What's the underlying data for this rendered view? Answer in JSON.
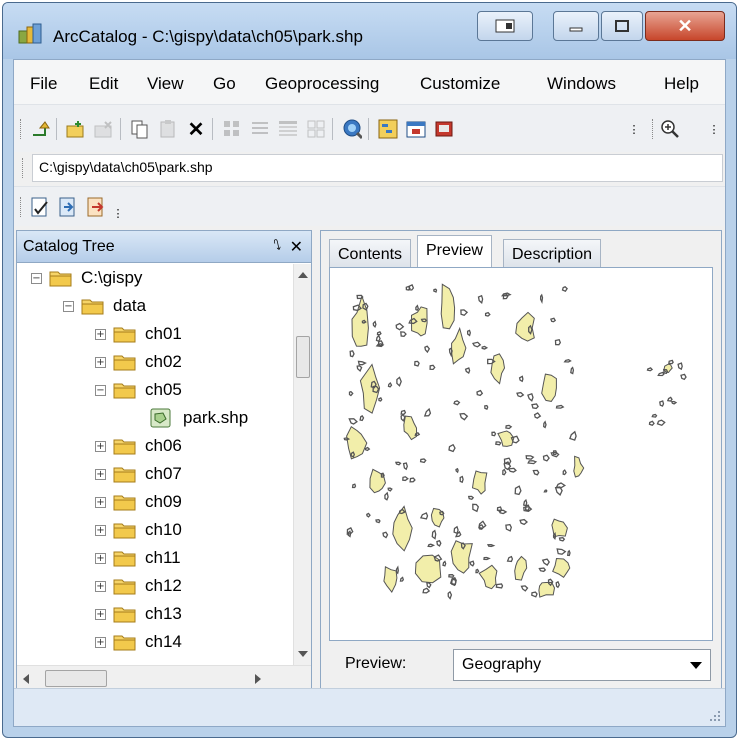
{
  "window": {
    "title": "ArcCatalog - C:\\gispy\\data\\ch05\\park.shp"
  },
  "menu": [
    "File",
    "Edit",
    "View",
    "Go",
    "Geoprocessing",
    "Customize",
    "Windows",
    "Help"
  ],
  "toolbar_icons": [
    "up-one-level-icon",
    "connect-folder-icon",
    "disconnect-folder-icon",
    "copy-icon",
    "paste-icon",
    "delete-icon",
    "large-icons-icon",
    "list-icon",
    "details-icon",
    "thumbnails-icon",
    "search-icon",
    "catalog-tree-icon",
    "arctoolbox-icon",
    "model-icon",
    "zoom-in-icon"
  ],
  "address": {
    "value": "C:\\gispy\\data\\ch05\\park.shp"
  },
  "catalog": {
    "title": "Catalog Tree",
    "pin": "⭛",
    "close": "✕",
    "items": [
      {
        "label": "C:\\gispy",
        "expander": "−",
        "level": 0,
        "type": "folder"
      },
      {
        "label": "data",
        "expander": "−",
        "level": 1,
        "type": "folder"
      },
      {
        "label": "ch01",
        "expander": "+",
        "level": 2,
        "type": "folder"
      },
      {
        "label": "ch02",
        "expander": "+",
        "level": 2,
        "type": "folder"
      },
      {
        "label": "ch05",
        "expander": "−",
        "level": 2,
        "type": "folder"
      },
      {
        "label": "park.shp",
        "expander": "",
        "level": 3,
        "type": "shapefile"
      },
      {
        "label": "ch06",
        "expander": "+",
        "level": 2,
        "type": "folder"
      },
      {
        "label": "ch07",
        "expander": "+",
        "level": 2,
        "type": "folder"
      },
      {
        "label": "ch09",
        "expander": "+",
        "level": 2,
        "type": "folder"
      },
      {
        "label": "ch10",
        "expander": "+",
        "level": 2,
        "type": "folder"
      },
      {
        "label": "ch11",
        "expander": "+",
        "level": 2,
        "type": "folder"
      },
      {
        "label": "ch12",
        "expander": "+",
        "level": 2,
        "type": "folder"
      },
      {
        "label": "ch13",
        "expander": "+",
        "level": 2,
        "type": "folder"
      },
      {
        "label": "ch14",
        "expander": "+",
        "level": 2,
        "type": "folder"
      }
    ]
  },
  "tabs": [
    {
      "label": "Contents",
      "active": false
    },
    {
      "label": "Preview",
      "active": true
    },
    {
      "label": "Description",
      "active": false
    }
  ],
  "preview": {
    "label": "Preview:",
    "value": "Geography"
  },
  "colors": {
    "polygon_fill": "#f2eeaa",
    "polygon_stroke": "#555555"
  }
}
